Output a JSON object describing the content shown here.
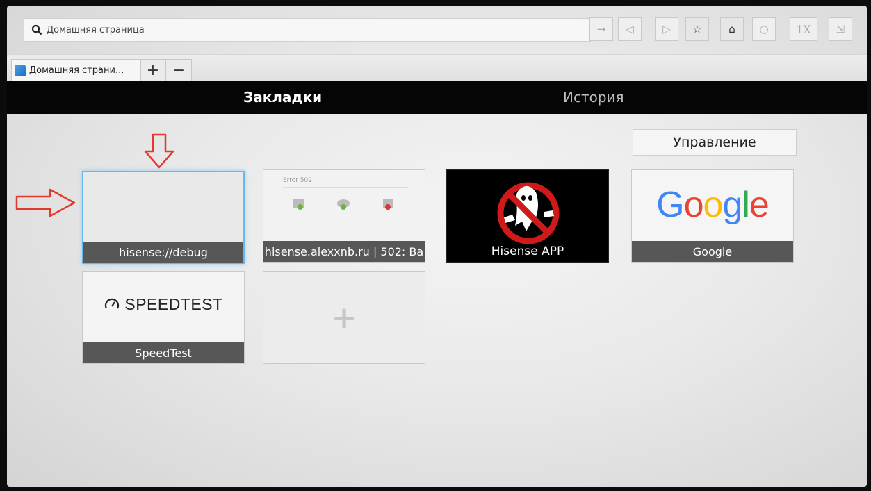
{
  "address_bar": {
    "search_icon": "search-icon",
    "url_text": "Домашняя страница"
  },
  "toolbar": {
    "buttons": [
      {
        "name": "go-arrow-icon",
        "glyph": "→"
      },
      {
        "name": "back-icon",
        "glyph": "◁"
      },
      {
        "name": "forward-icon",
        "glyph": "▷"
      },
      {
        "name": "star-icon",
        "glyph": "☆"
      },
      {
        "name": "home-icon",
        "glyph": "⌂"
      },
      {
        "name": "reload-icon",
        "glyph": "○"
      },
      {
        "name": "zoom-label",
        "glyph": "1X"
      },
      {
        "name": "exit-icon",
        "glyph": "⇲"
      }
    ]
  },
  "tabs": {
    "active_tab_label": "Домашняя страни...",
    "add_tab": "+",
    "close_tab": "−"
  },
  "sections": {
    "bookmarks": "Закладки",
    "history": "История"
  },
  "manage_button": "Управление",
  "tiles": {
    "debug": {
      "caption": "hisense://debug"
    },
    "alexxnb": {
      "caption": "hisense.alexxnb.ru | 502: Ba",
      "preview_title": "Error 502"
    },
    "hisense_app": {
      "caption": "Hisense APP"
    },
    "google": {
      "caption": "Google",
      "logo": "Google"
    },
    "speedtest": {
      "caption": "SpeedTest",
      "logo": "SPEEDTEST"
    },
    "add": {
      "glyph": "+"
    }
  },
  "colors": {
    "annotation_arrow": "#e03a2f",
    "focus_border": "#6ab7ee",
    "caption_bar": "#575757",
    "header_band": "#050505"
  }
}
